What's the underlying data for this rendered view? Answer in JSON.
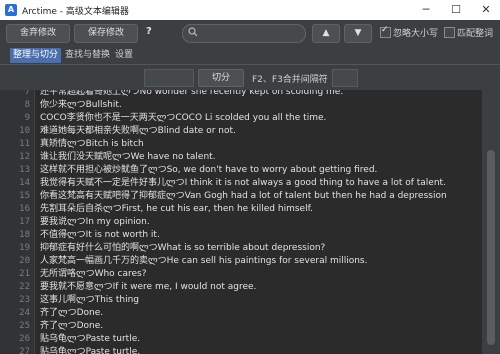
{
  "window": {
    "title": "Arctime - 高级文本编辑器",
    "logo_letter": "A",
    "minimize": "─",
    "maximize": "☐",
    "close": "✕"
  },
  "toolbar": {
    "discard_label": "舍弃修改",
    "save_label": "保存修改",
    "help_glyph": "?",
    "search_value": "",
    "search_placeholder": "",
    "up_glyph": "▲",
    "down_glyph": "▼",
    "ignore_case_label": "忽略大小写",
    "ignore_case_checked": true,
    "match_word_label": "匹配整词",
    "match_word_checked": false
  },
  "tabs": [
    {
      "label": "整理与切分",
      "active": true
    },
    {
      "label": "查找与替换",
      "active": false
    },
    {
      "label": "设置",
      "active": false
    }
  ],
  "split": {
    "field1_value": "",
    "split_button_label": "切分",
    "merge_label": "F2、F3合并间隔符",
    "field2_value": ""
  },
  "editor": {
    "lines": [
      {
        "n": "7",
        "t": "还平常超起着哥她上ლつNo wonder she recently kept on scolding me."
      },
      {
        "n": "8",
        "t": "你少来ლつBullshit."
      },
      {
        "n": "9",
        "t": "COCO李贤你也不是一天两天ლつCOCO Li scolded you all the time."
      },
      {
        "n": "10",
        "t": "难道她每天都相亲失败啊ლつBlind date or not."
      },
      {
        "n": "11",
        "t": "真矫情ლつBitch is bitch"
      },
      {
        "n": "12",
        "t": "谁让我们没天赋呢ლつWe have no talent."
      },
      {
        "n": "13",
        "t": "这样就不用担心被炒鱿鱼了ლつSo, we don't have to worry about getting fired."
      },
      {
        "n": "14",
        "t": "我觉得有天赋不一定是件好事儿ლつI think it is not always a good thing to have a lot of talent."
      },
      {
        "n": "15",
        "t": "你看这梵高有天赋吧得了抑郁症ლつVan Gogh had a lot of talent but then he had a depression"
      },
      {
        "n": "16",
        "t": "先割耳朵后自杀ლつFirst, he cut his ear, then he killed himself."
      },
      {
        "n": "17",
        "t": "要我说ლつIn my opinion."
      },
      {
        "n": "18",
        "t": "不值得ლつIt is not worth it."
      },
      {
        "n": "19",
        "t": "抑郁症有好什么可怕的啊ლつWhat is so terrible about depression?"
      },
      {
        "n": "20",
        "t": "人家梵高一幅画几千万的卖ლつHe can sell his paintings for several millions."
      },
      {
        "n": "21",
        "t": "无所谓咯ლつWho cares?"
      },
      {
        "n": "22",
        "t": "要我就不愿意ლつIf it were me, I would not agree."
      },
      {
        "n": "23",
        "t": "这事儿啊ლつThis thing"
      },
      {
        "n": "24",
        "t": "齐了ლつDone."
      },
      {
        "n": "25",
        "t": "齐了ლつDone."
      },
      {
        "n": "26",
        "t": "贴乌龟ლつPaste turtle."
      },
      {
        "n": "27",
        "t": "贴乌龟ლつPaste turtle."
      }
    ]
  }
}
